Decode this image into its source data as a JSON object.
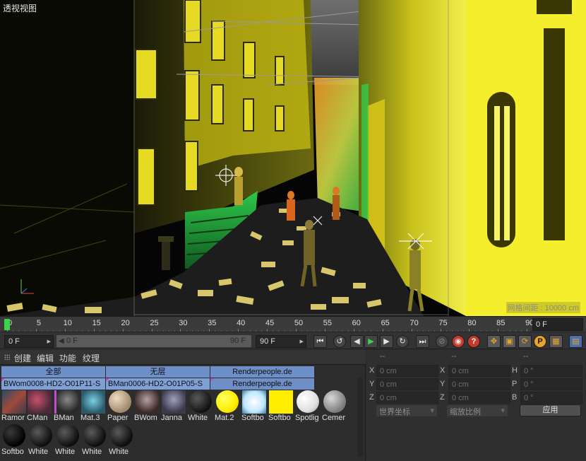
{
  "viewport": {
    "title": "透视视图",
    "grid_readout": "网格间距 : 10000 cm"
  },
  "timeline": {
    "ticks": [
      "0",
      "5",
      "10",
      "15",
      "20",
      "25",
      "30",
      "35",
      "40",
      "45",
      "50",
      "55",
      "60",
      "65",
      "70",
      "75",
      "80",
      "85",
      "90"
    ],
    "end_frame": "0 F"
  },
  "transport": {
    "start_frame": "0 F",
    "slider_left": "0 F",
    "slider_right": "90 F",
    "end_frame": "90 F",
    "buttons": [
      "go-to-start",
      "step-back",
      "play",
      "step-forward",
      "go-to-end",
      "record",
      "auto-key",
      "help",
      "move-tool",
      "scale-tool",
      "rotate-tool",
      "param-tool",
      "keyframe-grid",
      "film-strip"
    ]
  },
  "materials": {
    "menu": [
      "创建",
      "编辑",
      "功能",
      "纹理"
    ],
    "layer_tabs": [
      "全部",
      "无层",
      "Renderpeople.de"
    ],
    "layer_sub": [
      "BWom0008-HD2-O01P11-S",
      "BMan0006-HD2-O01P05-S",
      "Renderpeople.de"
    ],
    "row1": [
      "Ramor",
      "CMan",
      "BMan",
      "Mat.3",
      "Paper",
      "BWom",
      "Janna",
      "White",
      "Mat.2",
      "Softbo",
      "Softbo",
      "Spotlig",
      "Cemer"
    ],
    "row2": [
      "Softbo",
      "White",
      "White",
      "White",
      "White"
    ],
    "swatch_colors": {
      "yellow": "#ffee00",
      "softbox_glow": "#e8f6ff",
      "white": "#f2f2f2",
      "black": "#0d0d0d",
      "layer_blue": "#6e8fc8"
    }
  },
  "coordinates": {
    "headers": [
      "--",
      "--",
      "--"
    ],
    "rows": [
      {
        "a_label": "X",
        "a_val": "0 cm",
        "b_label": "X",
        "b_val": "0 cm",
        "c_label": "H",
        "c_val": "0 °"
      },
      {
        "a_label": "Y",
        "a_val": "0 cm",
        "b_label": "Y",
        "b_val": "0 cm",
        "c_label": "P",
        "c_val": "0 °"
      },
      {
        "a_label": "Z",
        "a_val": "0 cm",
        "b_label": "Z",
        "b_val": "0 cm",
        "c_label": "B",
        "c_val": "0 °"
      }
    ],
    "space_dropdown": "世界坐标",
    "scale_dropdown": "缩放比例",
    "apply_label": "应用"
  }
}
